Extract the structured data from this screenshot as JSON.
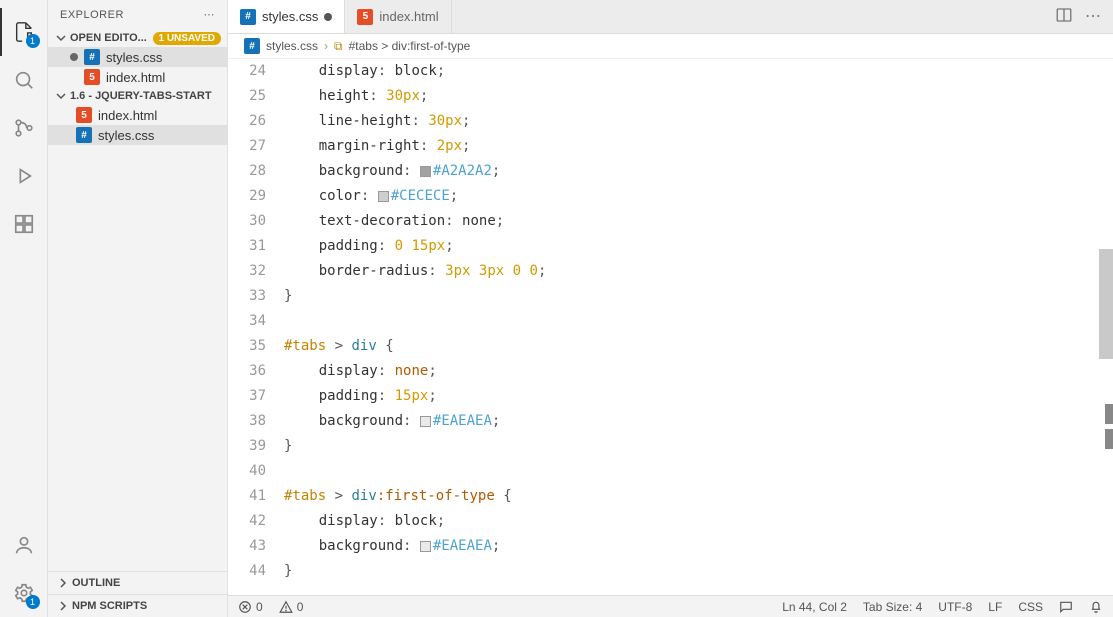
{
  "sidebar": {
    "title": "EXPLORER",
    "openEditors": {
      "label": "OPEN EDITO...",
      "unsaved": "1 UNSAVED",
      "items": [
        {
          "name": "styles.css",
          "modified": true,
          "type": "css"
        },
        {
          "name": "index.html",
          "modified": false,
          "type": "html"
        }
      ]
    },
    "project": {
      "label": "1.6 - JQUERY-TABS-START",
      "items": [
        {
          "name": "index.html",
          "type": "html"
        },
        {
          "name": "styles.css",
          "type": "css",
          "active": true
        }
      ]
    },
    "outline": "OUTLINE",
    "npm": "NPM SCRIPTS"
  },
  "activity": {
    "badgeExplorer": "1",
    "badgeSettings": "1"
  },
  "tabs": [
    {
      "name": "styles.css",
      "type": "css",
      "modified": true,
      "active": true
    },
    {
      "name": "index.html",
      "type": "html",
      "modified": false,
      "active": false
    }
  ],
  "breadcrumb": {
    "file": "styles.css",
    "symbol": "#tabs > div:first-of-type"
  },
  "code": {
    "startLine": 24,
    "lines": [
      {
        "indent": 2,
        "html": "<span class='tok-prop'>display</span><span class='tok-punc'>:</span> <span class='tok-prop'>block</span><span class='tok-punc'>;</span>"
      },
      {
        "indent": 2,
        "html": "<span class='tok-prop'>height</span><span class='tok-punc'>:</span> <span class='tok-num'>30px</span><span class='tok-punc'>;</span>"
      },
      {
        "indent": 2,
        "html": "<span class='tok-prop'>line-height</span><span class='tok-punc'>:</span> <span class='tok-num'>30px</span><span class='tok-punc'>;</span>"
      },
      {
        "indent": 2,
        "html": "<span class='tok-prop'>margin-right</span><span class='tok-punc'>:</span> <span class='tok-num'>2px</span><span class='tok-punc'>;</span>"
      },
      {
        "indent": 2,
        "html": "<span class='tok-prop'>background</span><span class='tok-punc'>:</span> <span class='swatch' style='background:#A2A2A2'></span><span class='tok-hex'>#A2A2A2</span><span class='tok-punc'>;</span>"
      },
      {
        "indent": 2,
        "html": "<span class='tok-prop'>color</span><span class='tok-punc'>:</span> <span class='swatch' style='background:#CECECE'></span><span class='tok-hex'>#CECECE</span><span class='tok-punc'>;</span>"
      },
      {
        "indent": 2,
        "html": "<span class='tok-prop'>text-decoration</span><span class='tok-punc'>:</span> <span class='tok-prop'>none</span><span class='tok-punc'>;</span>"
      },
      {
        "indent": 2,
        "html": "<span class='tok-prop'>padding</span><span class='tok-punc'>:</span> <span class='tok-num'>0</span> <span class='tok-num'>15px</span><span class='tok-punc'>;</span>"
      },
      {
        "indent": 2,
        "html": "<span class='tok-prop'>border-radius</span><span class='tok-punc'>:</span> <span class='tok-num'>3px</span> <span class='tok-num'>3px</span> <span class='tok-num'>0</span> <span class='tok-num'>0</span><span class='tok-punc'>;</span>"
      },
      {
        "indent": 0,
        "html": "<span class='tok-punc'>}</span>"
      },
      {
        "indent": 0,
        "html": ""
      },
      {
        "indent": 0,
        "html": "<span class='tok-id'>#tabs</span> <span class='tok-punc'>&gt;</span> <span class='tok-tag'>div</span> <span class='tok-punc'>{</span>"
      },
      {
        "indent": 2,
        "html": "<span class='tok-prop'>display</span><span class='tok-punc'>:</span> <span class='tok-none'>none</span><span class='tok-punc'>;</span>"
      },
      {
        "indent": 2,
        "html": "<span class='tok-prop'>padding</span><span class='tok-punc'>:</span> <span class='tok-num'>15px</span><span class='tok-punc'>;</span>"
      },
      {
        "indent": 2,
        "html": "<span class='tok-prop'>background</span><span class='tok-punc'>:</span> <span class='swatch' style='background:#EAEAEA'></span><span class='tok-hex'>#EAEAEA</span><span class='tok-punc'>;</span>"
      },
      {
        "indent": 0,
        "html": "<span class='tok-punc'>}</span>"
      },
      {
        "indent": 0,
        "html": ""
      },
      {
        "indent": 0,
        "html": "<span class='tok-id'>#tabs</span> <span class='tok-punc'>&gt;</span> <span class='tok-tag'>div</span><span class='tok-pseudo'>:first-of-type</span> <span class='tok-punc'>{</span>"
      },
      {
        "indent": 2,
        "html": "<span class='tok-prop'>display</span><span class='tok-punc'>:</span> <span class='tok-prop'>block</span><span class='tok-punc'>;</span>"
      },
      {
        "indent": 2,
        "html": "<span class='tok-prop'>background</span><span class='tok-punc'>:</span> <span class='swatch' style='background:#EAEAEA'></span><span class='tok-hex'>#EAEAEA</span><span class='tok-punc'>;</span>"
      },
      {
        "indent": 0,
        "html": "<span class='tok-punc'>}</span>"
      }
    ]
  },
  "statusbar": {
    "errors": "0",
    "warnings": "0",
    "lncol": "Ln 44, Col 2",
    "tabsize": "Tab Size: 4",
    "encoding": "UTF-8",
    "eol": "LF",
    "lang": "CSS"
  }
}
